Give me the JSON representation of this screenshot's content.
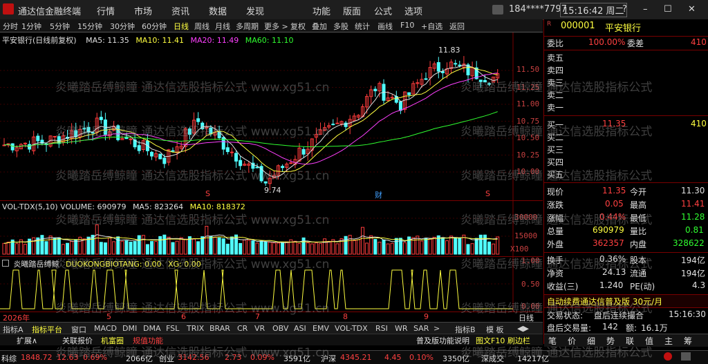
{
  "titlebar": {
    "app_title": "通达信金融终端",
    "menus": [
      "行情",
      "市场",
      "资讯",
      "数据",
      "发现",
      "功能",
      "版面",
      "公式",
      "选项"
    ],
    "user": "184****7797",
    "clock": "15:16:42 周二"
  },
  "toolbar": {
    "items": [
      "分时",
      "1分钟",
      "5分钟",
      "15分钟",
      "30分钟",
      "60分钟",
      "日线",
      "周线",
      "月线",
      "多周期",
      "更多 >",
      "复权",
      "叠加",
      "多股",
      "统计",
      "画线",
      "F10",
      "+自选",
      "返回"
    ],
    "active": "日线"
  },
  "main_chart": {
    "title": "平安银行(日线前复权)",
    "ma_labels": [
      {
        "text": "MA5: 11.35",
        "color": "#e0e0e0"
      },
      {
        "text": "MA10: 11.41",
        "color": "#ffff40"
      },
      {
        "text": "MA20: 11.49",
        "color": "#ff40ff"
      },
      {
        "text": "MA60: 11.10",
        "color": "#30ff30"
      }
    ],
    "high_label": "11.83",
    "low_label": "9.74",
    "y_ticks": [
      "11.50",
      "11.25",
      "11.00",
      "10.75",
      "10.50",
      "10.25",
      "10.00"
    ],
    "markers": [
      "S",
      "财",
      "S"
    ]
  },
  "volume_chart": {
    "title": "VOL-TDX(5,10) VOLUME: 690979",
    "ma5": "MA5: 823264",
    "ma10": "MA10: 818372",
    "y_ticks": [
      "30000",
      "15000"
    ],
    "unit": "X100"
  },
  "indicator_chart": {
    "title": "炎曦踏岳缚鲸",
    "line1": "DUOKONGBIOTANG: 0.00",
    "line2": "XG: 0.00",
    "y_ticks": [
      "1.00",
      "0.50",
      "0.00"
    ]
  },
  "time_axis": {
    "labels": [
      "2026年",
      "5",
      "6",
      "7",
      "8",
      "9"
    ],
    "period": "日线"
  },
  "tabs": [
    "指标A",
    "指标平台",
    "窗口",
    "MACD",
    "DMI",
    "DMA",
    "FSL",
    "TRIX",
    "BRAR",
    "CR",
    "VR",
    "OBV",
    "ASI",
    "EMV",
    "VOL-TDX",
    "RSI",
    "WR",
    "SAR",
    ">",
    "指标B",
    "模 板",
    "◀▶"
  ],
  "subbar": {
    "left": [
      "扩展∧",
      "关联报价",
      "机富圈",
      "规值功能"
    ],
    "right_ad": "普及版功能说明",
    "f10": "图文F10 刷边栏",
    "quote_tab": "笔",
    "quote_tab2": "价",
    "quote_tab3": "细",
    "quote_tab4": "势",
    "quote_tab5": "联",
    "quote_tab6": "值",
    "quote_tab7": "主",
    "quote_tab8": "筹"
  },
  "stock": {
    "code": "000001",
    "name": "平安银行",
    "weibi_label": "委比",
    "weibi": "100.00%",
    "weicha_label": "委差",
    "weicha": "410",
    "asks": [
      {
        "label": "卖五",
        "price": "",
        "vol": ""
      },
      {
        "label": "卖四",
        "price": "",
        "vol": ""
      },
      {
        "label": "卖三",
        "price": "",
        "vol": ""
      },
      {
        "label": "卖二",
        "price": "",
        "vol": ""
      },
      {
        "label": "卖一",
        "price": "",
        "vol": ""
      }
    ],
    "bids": [
      {
        "label": "买一",
        "price": "11.35",
        "vol": "410"
      },
      {
        "label": "买二",
        "price": "",
        "vol": ""
      },
      {
        "label": "买三",
        "price": "",
        "vol": ""
      },
      {
        "label": "买四",
        "price": "",
        "vol": ""
      },
      {
        "label": "买五",
        "price": "",
        "vol": ""
      }
    ],
    "stats": [
      {
        "l1": "现价",
        "v1": "11.35",
        "c1": "red",
        "l2": "今开",
        "v2": "11.30",
        "c2": "white"
      },
      {
        "l1": "涨跌",
        "v1": "0.05",
        "c1": "red",
        "l2": "最高",
        "v2": "11.41",
        "c2": "red"
      },
      {
        "l1": "涨幅",
        "v1": "0.44%",
        "c1": "red",
        "l2": "最低",
        "v2": "11.28",
        "c2": "green"
      },
      {
        "l1": "总量",
        "v1": "690979",
        "c1": "yellow",
        "l2": "量比",
        "v2": "0.81",
        "c2": "green"
      },
      {
        "l1": "外盘",
        "v1": "362357",
        "c1": "red",
        "l2": "内盘",
        "v2": "328622",
        "c2": "green"
      }
    ],
    "stats2": [
      {
        "l1": "换手",
        "v1": "0.36%",
        "l2": "股本",
        "v2": "194亿"
      },
      {
        "l1": "净资",
        "v1": "24.13",
        "l2": "流通",
        "v2": "194亿"
      },
      {
        "l1": "收益(三)",
        "v1": "1.240",
        "l2": "PE(动)",
        "v2": "4.3"
      }
    ],
    "ad_banner": "自动续费通达信普及版 30元/月",
    "trade_status_label": "交易状态:",
    "trade_status": "盘后连续撮合",
    "trade_time": "15:16:30",
    "after_vol_label": "盘后交易量:",
    "after_vol": "142",
    "after_amt_label": "额:",
    "after_amt": "16.1万"
  },
  "statusbar": [
    {
      "name": "科综",
      "value": "1848.72",
      "chg": "12.63",
      "pct": "0.69%",
      "amt": "2066亿"
    },
    {
      "name": "创业",
      "value": "3142.56",
      "chg": "2.73",
      "pct": "0.09%",
      "amt": "3591亿"
    },
    {
      "name": "沪深",
      "value": "4345.21",
      "chg": "4.45",
      "pct": "0.10%",
      "amt": "3350亿"
    },
    {
      "name": "深成交",
      "value": "",
      "chg": "",
      "pct": "",
      "amt": "14217亿"
    }
  ],
  "watermark": [
    "炎曦踏岳缚鲸瞳 通达信选股指标公式 www.xg51.cn"
  ]
}
